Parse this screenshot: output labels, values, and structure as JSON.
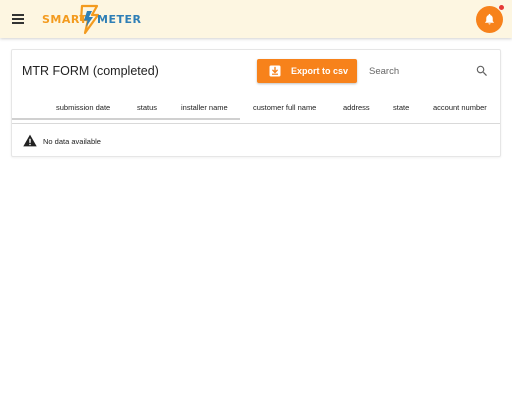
{
  "header": {
    "menu_icon": "hamburger-menu-icon",
    "logo": {
      "text_left": "SMART",
      "text_right": "METER",
      "icon": "lightning-bolt-icon"
    },
    "notifications": {
      "icon": "bell-icon",
      "has_unread": true
    }
  },
  "colors": {
    "accent": "#f7821b",
    "header_background": "#fdf6e1",
    "logo_blue": "#2f7fb6",
    "logo_orange": "#f39b1f",
    "badge_red": "#e53935"
  },
  "card": {
    "title": "MTR FORM (completed)",
    "export_label": "Export to csv",
    "export_icon": "file-download-icon",
    "search": {
      "placeholder": "Search",
      "value": "",
      "icon": "search-icon"
    },
    "columns": [
      "submission date",
      "status",
      "installer name",
      "customer full name",
      "address",
      "state",
      "account number"
    ],
    "empty_state": {
      "icon": "warning-icon",
      "message": "No data available"
    }
  }
}
